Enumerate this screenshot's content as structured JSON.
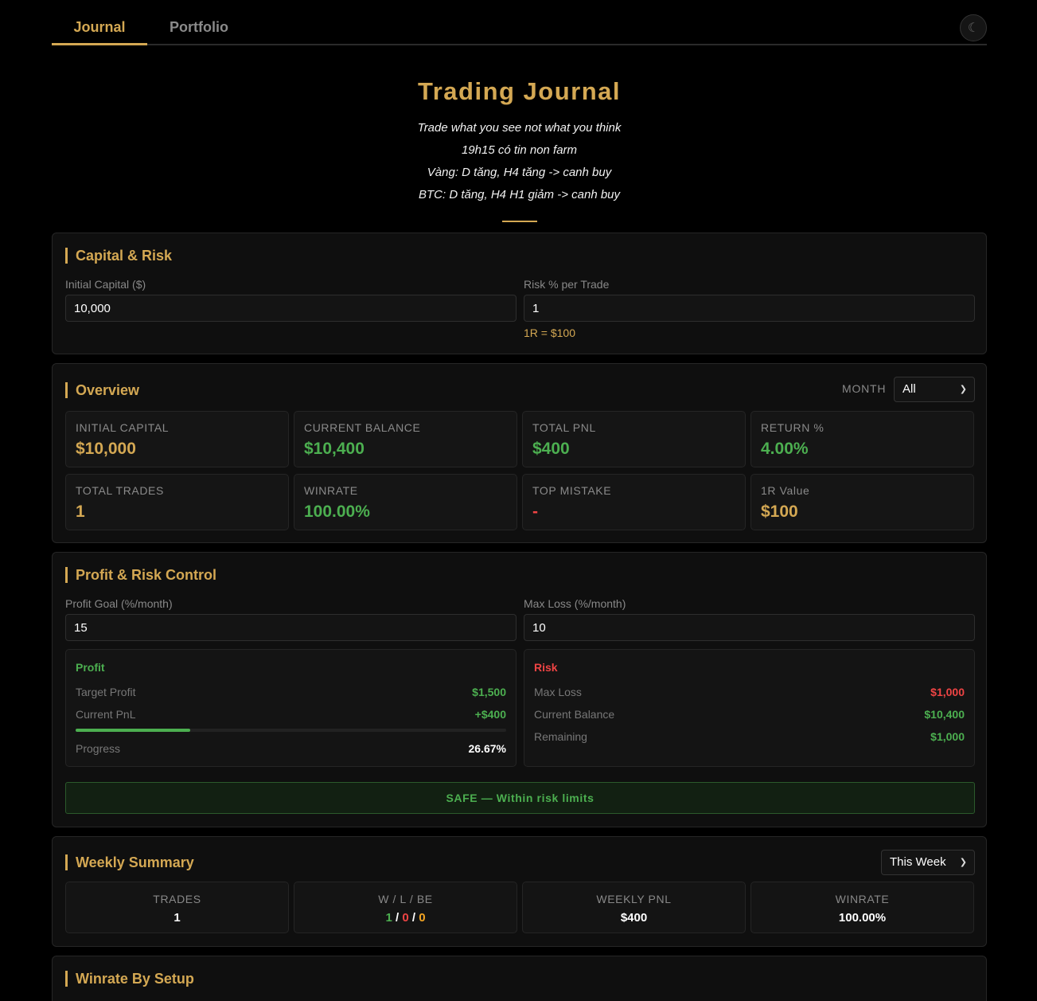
{
  "tabs": [
    {
      "label": "Journal",
      "active": true
    },
    {
      "label": "Portfolio",
      "active": false
    }
  ],
  "theme_toggle": {
    "icon": "moon-icon",
    "glyph": "☾"
  },
  "header": {
    "title": "Trading Journal",
    "lines": [
      "Trade what you see not what you think",
      "19h15 có tin non farm",
      "Vàng: D tăng, H4 tăng -> canh buy",
      "BTC: D tăng, H4 H1 giảm -> canh buy"
    ]
  },
  "capital": {
    "title": "Capital & Risk",
    "initial_label": "Initial Capital ($)",
    "initial_value": "10,000",
    "risk_label": "Risk % per Trade",
    "risk_value": "1",
    "r_hint": "1R = $100"
  },
  "overview": {
    "title": "Overview",
    "month_label": "MONTH",
    "month_value": "All",
    "stats": [
      {
        "label": "Initial Capital",
        "value": "$10,000",
        "color": "#d4a853"
      },
      {
        "label": "Current Balance",
        "value": "$10,400",
        "color": "#4caf50"
      },
      {
        "label": "Total PnL",
        "value": "$400",
        "color": "#4caf50"
      },
      {
        "label": "Return %",
        "value": "4.00%",
        "color": "#4caf50"
      },
      {
        "label": "Total Trades",
        "value": "1",
        "color": "#d4a853"
      },
      {
        "label": "Winrate",
        "value": "100.00%",
        "color": "#4caf50"
      },
      {
        "label": "Top Mistake",
        "value": "-",
        "color": "#ef4444"
      },
      {
        "label": "1R Value",
        "value": "$100",
        "color": "#d4a853"
      }
    ]
  },
  "profit_risk": {
    "title": "Profit & Risk Control",
    "goal_label": "Profit Goal (%/month)",
    "goal_value": "15",
    "maxloss_label": "Max Loss (%/month)",
    "maxloss_value": "10",
    "profit": {
      "title": "Profit",
      "target_label": "Target Profit",
      "target_value": "$1,500",
      "pnl_label": "Current PnL",
      "pnl_value": "+$400",
      "progress_label": "Progress",
      "progress_value": "26.67%",
      "progress_fraction": 0.2667
    },
    "risk": {
      "title": "Risk",
      "maxloss_label": "Max Loss",
      "maxloss_value": "$1,000",
      "balance_label": "Current Balance",
      "balance_value": "$10,400",
      "remaining_label": "Remaining",
      "remaining_value": "$1,000"
    },
    "status": "SAFE — Within risk limits"
  },
  "weekly": {
    "title": "Weekly Summary",
    "period_value": "This Week",
    "trades_label": "TRADES",
    "trades_value": "1",
    "wlbe_label": "W / L / BE",
    "wins": "1",
    "losses": "0",
    "breakeven": "0",
    "pnl_label": "WEEKLY PNL",
    "pnl_value": "$400",
    "winrate_label": "WINRATE",
    "winrate_value": "100.00%"
  },
  "setup": {
    "title": "Winrate By Setup"
  }
}
